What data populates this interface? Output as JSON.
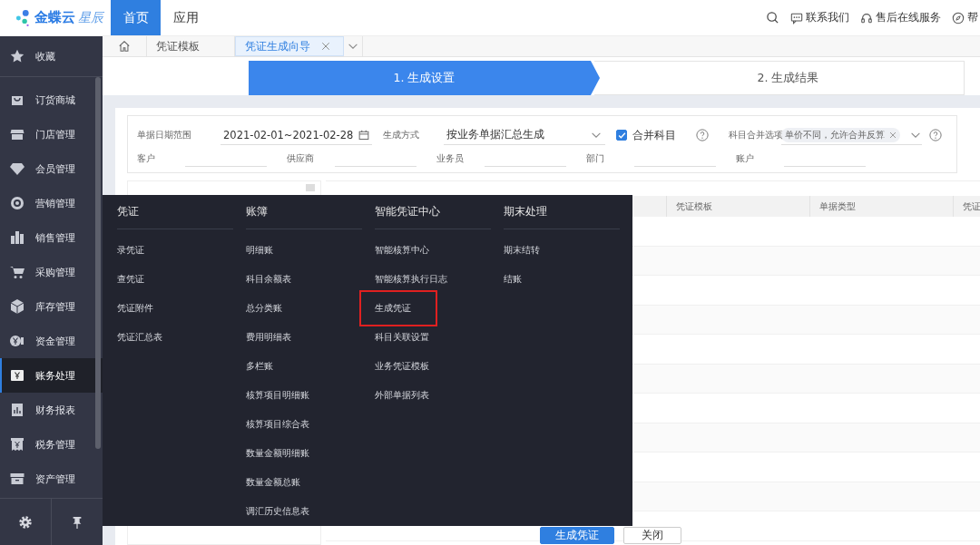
{
  "logo": {
    "name": "金蝶云",
    "product": "星辰"
  },
  "nav_tabs": [
    {
      "label": "首页",
      "selected": true
    },
    {
      "label": "应用",
      "selected": false
    }
  ],
  "top_links": [
    {
      "label": "联系我们"
    },
    {
      "label": "售后在线服务"
    },
    {
      "label": "帮"
    }
  ],
  "sidebar": {
    "favorites": {
      "label": "收藏"
    },
    "items": [
      {
        "label": "订货商城",
        "selected": false
      },
      {
        "label": "门店管理",
        "selected": false
      },
      {
        "label": "会员管理",
        "selected": false
      },
      {
        "label": "营销管理",
        "selected": false
      },
      {
        "label": "销售管理",
        "selected": false
      },
      {
        "label": "采购管理",
        "selected": false
      },
      {
        "label": "库存管理",
        "selected": false
      },
      {
        "label": "资金管理",
        "selected": false
      },
      {
        "label": "账务处理",
        "selected": true
      },
      {
        "label": "财务报表",
        "selected": false
      },
      {
        "label": "税务管理",
        "selected": false
      },
      {
        "label": "资产管理",
        "selected": false
      }
    ]
  },
  "page_tabs": [
    {
      "label": "凭证模板",
      "selected": false
    },
    {
      "label": "凭证生成向导",
      "selected": true
    }
  ],
  "steps": [
    {
      "label": "1. 生成设置",
      "selected": true
    },
    {
      "label": "2. 生成结果",
      "selected": false
    }
  ],
  "filters": {
    "date_range": {
      "label": "单据日期范围",
      "value": "2021-02-01~2021-02-28"
    },
    "method": {
      "label": "生成方式",
      "value": "按业务单据汇总生成"
    },
    "merge_subjects": {
      "label": "合并科目",
      "checked": true
    },
    "merge_options": {
      "label": "科目合并选项",
      "tags": [
        "单价不同，允许合并反算"
      ]
    },
    "parties": [
      {
        "label": "客户"
      },
      {
        "label": "供应商"
      },
      {
        "label": "业务员"
      },
      {
        "label": "部门"
      },
      {
        "label": "账户"
      }
    ]
  },
  "table": {
    "columns": [
      "凭证模板",
      "单据类型",
      "凭证"
    ]
  },
  "menu": {
    "columns": [
      {
        "title": "凭证",
        "items": [
          {
            "label": "录凭证",
            "highlighted": false
          },
          {
            "label": "查凭证",
            "highlighted": false
          },
          {
            "label": "凭证附件",
            "highlighted": false
          },
          {
            "label": "凭证汇总表",
            "highlighted": false
          }
        ]
      },
      {
        "title": "账簿",
        "items": [
          {
            "label": "明细账",
            "highlighted": false
          },
          {
            "label": "科目余额表",
            "highlighted": false
          },
          {
            "label": "总分类账",
            "highlighted": false
          },
          {
            "label": "费用明细表",
            "highlighted": false
          },
          {
            "label": "多栏账",
            "highlighted": false
          },
          {
            "label": "核算项目明细账",
            "highlighted": false
          },
          {
            "label": "核算项目综合表",
            "highlighted": false
          },
          {
            "label": "数量金额明细账",
            "highlighted": false
          },
          {
            "label": "数量金额总账",
            "highlighted": false
          },
          {
            "label": "调汇历史信息表",
            "highlighted": false
          }
        ]
      },
      {
        "title": "智能凭证中心",
        "items": [
          {
            "label": "智能核算中心",
            "highlighted": false
          },
          {
            "label": "智能核算执行日志",
            "highlighted": false
          },
          {
            "label": "生成凭证",
            "highlighted": true
          },
          {
            "label": "科目关联设置",
            "highlighted": false
          },
          {
            "label": "业务凭证模板",
            "highlighted": false
          },
          {
            "label": "外部单据列表",
            "highlighted": false
          }
        ]
      },
      {
        "title": "期末处理",
        "items": [
          {
            "label": "期末结转",
            "highlighted": false
          },
          {
            "label": "结账",
            "highlighted": false
          }
        ]
      }
    ]
  },
  "buttons": [
    {
      "label": "生成凭证",
      "kind": "primary"
    },
    {
      "label": "关闭",
      "kind": "default"
    }
  ]
}
